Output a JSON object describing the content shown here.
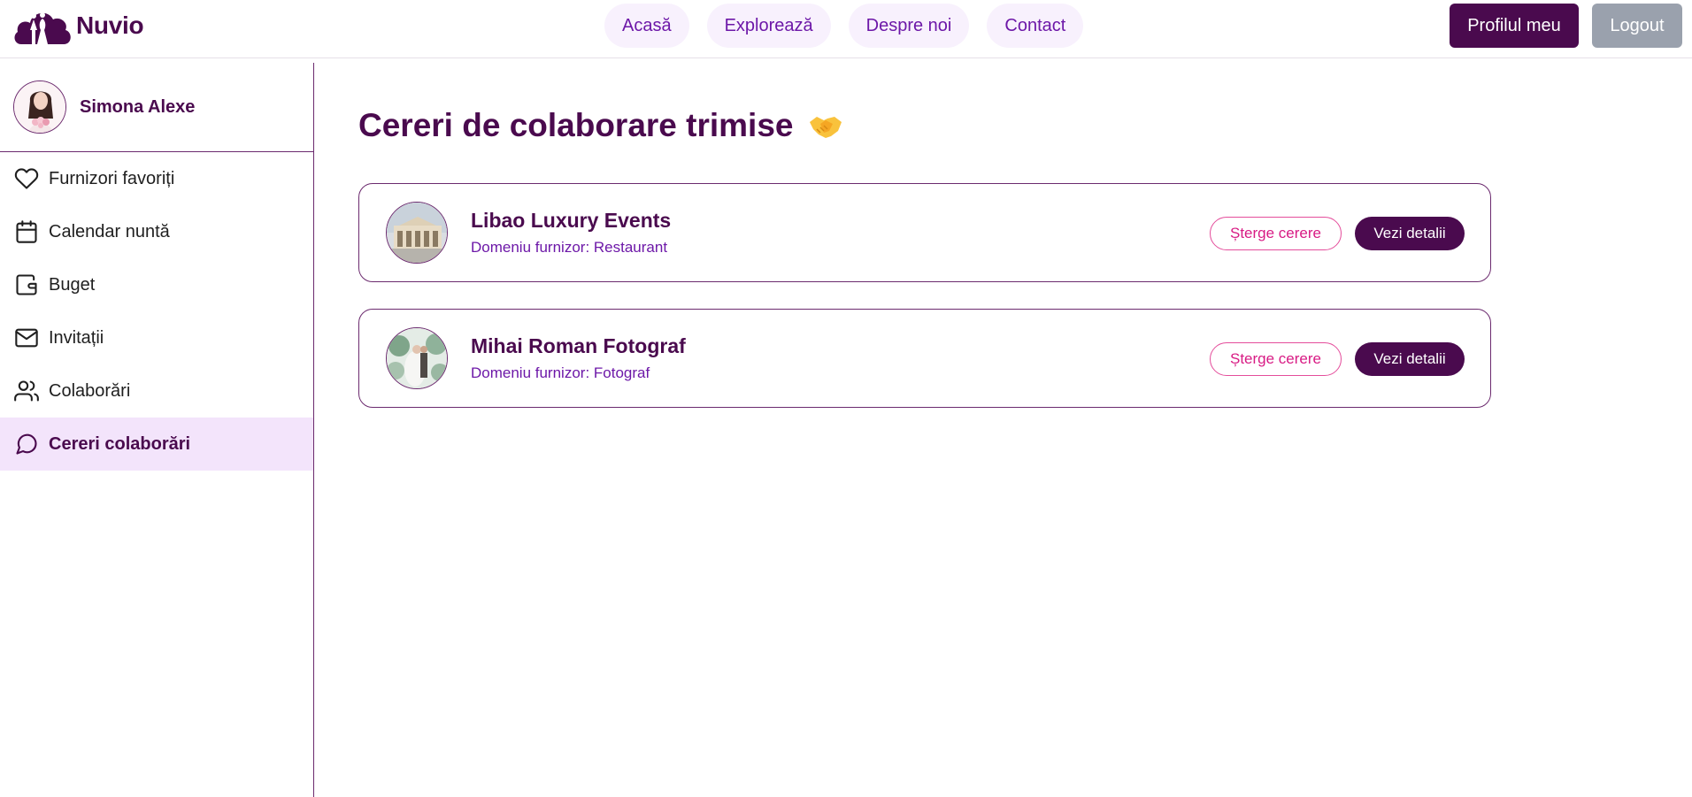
{
  "header": {
    "brand": "Nuvio",
    "nav": [
      {
        "label": "Acasă"
      },
      {
        "label": "Explorează"
      },
      {
        "label": "Despre noi"
      },
      {
        "label": "Contact"
      }
    ],
    "profile_button": "Profilul meu",
    "logout_button": "Logout"
  },
  "sidebar": {
    "user_name": "Simona Alexe",
    "items": [
      {
        "label": "Furnizori favoriți",
        "icon": "heart-icon"
      },
      {
        "label": "Calendar nuntă",
        "icon": "calendar-icon"
      },
      {
        "label": "Buget",
        "icon": "wallet-icon"
      },
      {
        "label": "Invitații",
        "icon": "mail-icon"
      },
      {
        "label": "Colaborări",
        "icon": "users-icon"
      },
      {
        "label": "Cereri colaborări",
        "icon": "message-circle-icon",
        "active": true
      }
    ]
  },
  "main": {
    "title": "Cereri de colaborare trimise",
    "title_emoji": "handshake-icon",
    "requests": [
      {
        "name": "Libao Luxury Events",
        "domain": "Domeniu furnizor: Restaurant",
        "delete_label": "Șterge cerere",
        "details_label": "Vezi detalii"
      },
      {
        "name": "Mihai Roman Fotograf",
        "domain": "Domeniu furnizor: Fotograf",
        "delete_label": "Șterge cerere",
        "details_label": "Vezi detalii"
      }
    ]
  },
  "colors": {
    "brand_dark": "#4a0a4e",
    "accent_purple": "#6d18a8",
    "pill_bg": "#f8f1fd",
    "active_bg": "#f3e4fb",
    "delete_pink": "#d81b84",
    "logout_gray": "#9aa1ad"
  }
}
